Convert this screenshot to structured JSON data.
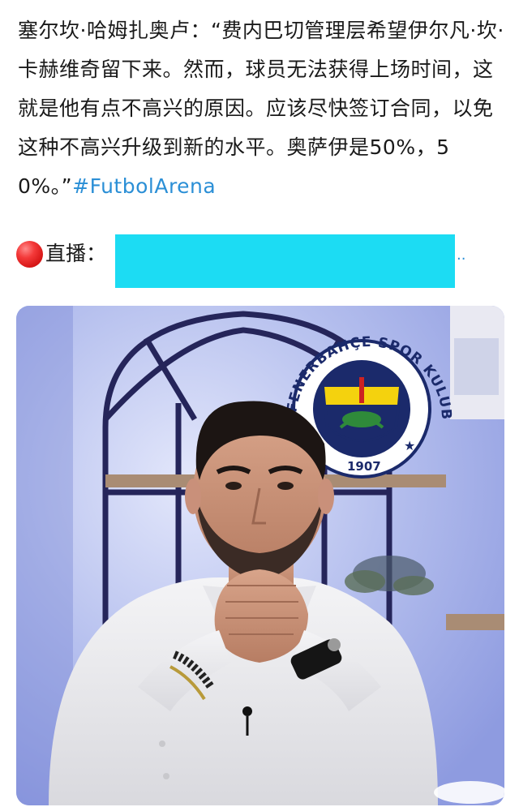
{
  "post": {
    "text": "塞尔坎·哈姆扎奥卢：“费内巴切管理层希望伊尔凡·坎·卡赫维奇留下来。然而，球员无法获得上场时间，这就是他有点不高兴的原因。应该尽快签订合同，以免这种不高兴升级到新的水平。奥萨伊是50%，50%。”",
    "hashtag": "#FutbolArena"
  },
  "live": {
    "label": "直播：",
    "ellipsis": "..",
    "dot_color": "#e52424",
    "redaction_color": "#1cdcf3"
  },
  "photo": {
    "logo_top_text": "FENERBAHÇE SPOR KULUBU",
    "logo_year": "1907"
  },
  "colors": {
    "hashtag": "#2b8fd6"
  }
}
